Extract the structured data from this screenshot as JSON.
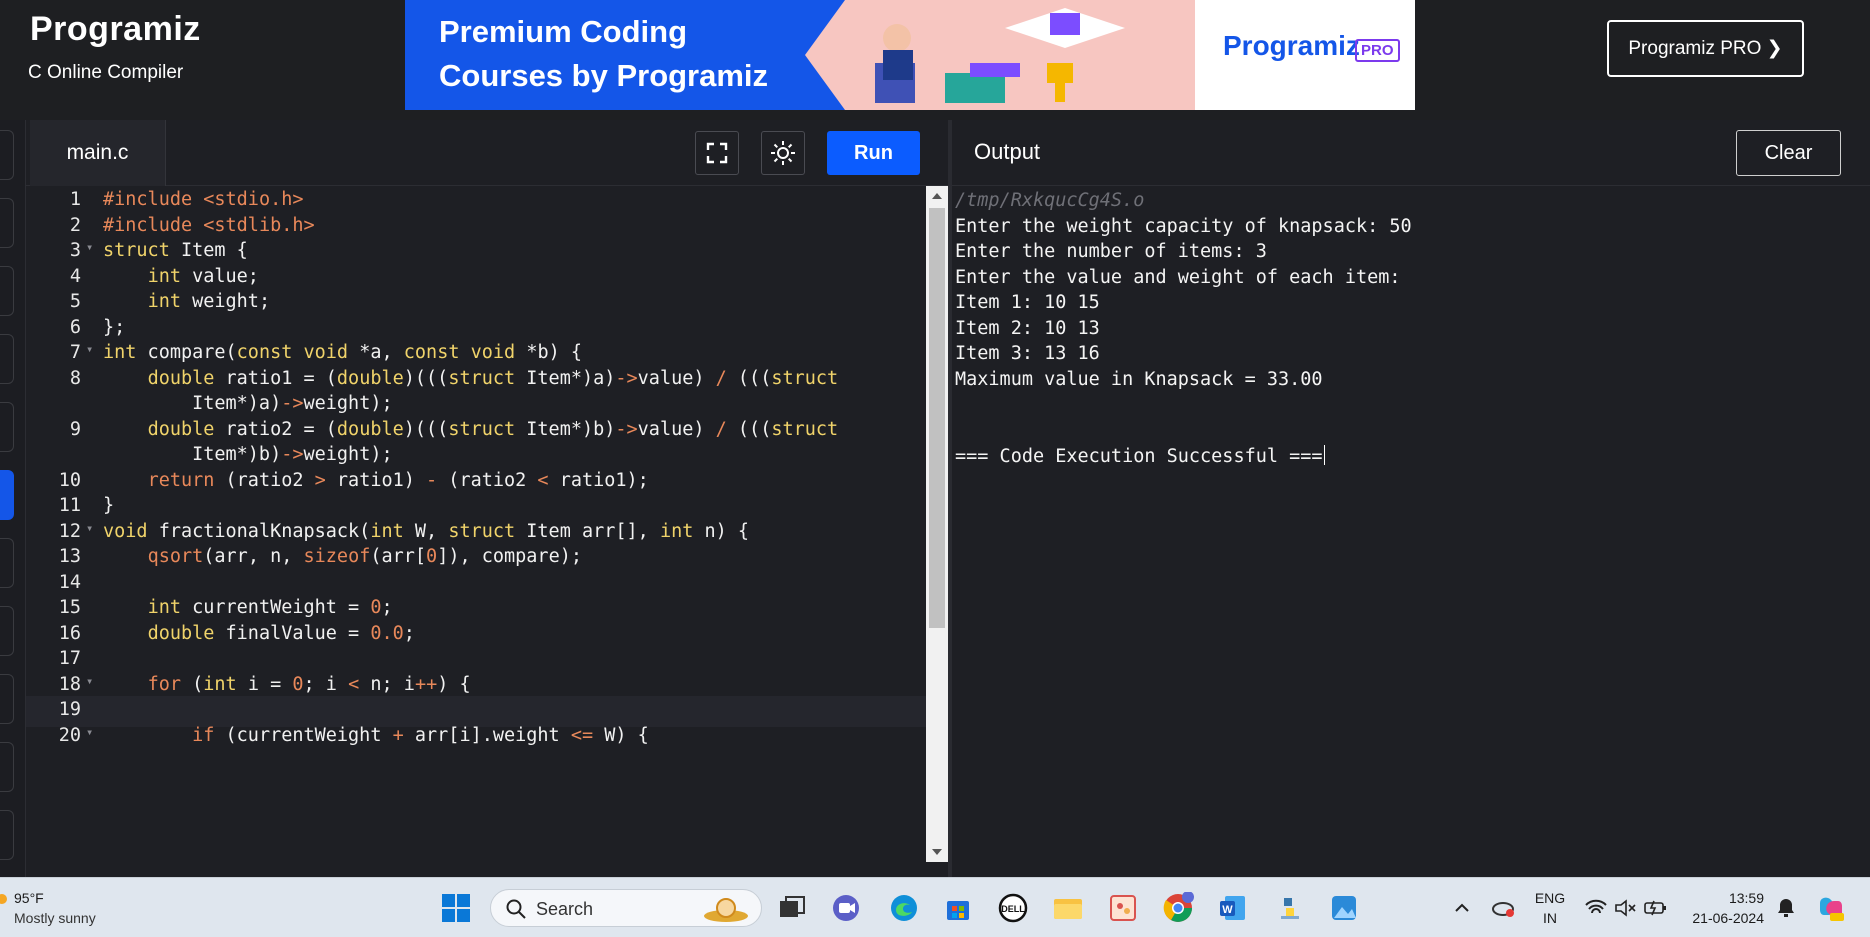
{
  "header": {
    "logo": "Programiz",
    "subtitle": "C Online Compiler",
    "banner_line1": "Premium Coding",
    "banner_line2": "Courses by Programiz",
    "banner_logo": "Programiz",
    "banner_badge": "PRO",
    "pro_button": "Programiz PRO ❯"
  },
  "editor": {
    "tab_label": "main.c",
    "run_label": "Run",
    "lines": [
      {
        "n": "1",
        "fold": false
      },
      {
        "n": "2",
        "fold": false
      },
      {
        "n": "3",
        "fold": true
      },
      {
        "n": "4",
        "fold": false
      },
      {
        "n": "5",
        "fold": false
      },
      {
        "n": "6",
        "fold": false
      },
      {
        "n": "7",
        "fold": true
      },
      {
        "n": "8",
        "fold": false
      },
      {
        "n": "",
        "fold": false
      },
      {
        "n": "9",
        "fold": false
      },
      {
        "n": "",
        "fold": false
      },
      {
        "n": "10",
        "fold": false
      },
      {
        "n": "11",
        "fold": false
      },
      {
        "n": "12",
        "fold": true
      },
      {
        "n": "13",
        "fold": false
      },
      {
        "n": "14",
        "fold": false
      },
      {
        "n": "15",
        "fold": false
      },
      {
        "n": "16",
        "fold": false
      },
      {
        "n": "17",
        "fold": false
      },
      {
        "n": "18",
        "fold": true
      },
      {
        "n": "19",
        "fold": false
      },
      {
        "n": "20",
        "fold": true
      }
    ],
    "code": [
      "#include <stdio.h>",
      "#include <stdlib.h>",
      "struct Item {",
      "    int value;",
      "    int weight;",
      "};",
      "int compare(const void *a, const void *b) {",
      "    double ratio1 = (double)(((struct Item*)a)->value) / (((struct",
      "        Item*)a)->weight);",
      "    double ratio2 = (double)(((struct Item*)b)->value) / (((struct",
      "        Item*)b)->weight);",
      "    return (ratio2 > ratio1) - (ratio2 < ratio1);",
      "}",
      "void fractionalKnapsack(int W, struct Item arr[], int n) {",
      "    qsort(arr, n, sizeof(arr[0]), compare);",
      "",
      "    int currentWeight = 0;",
      "    double finalValue = 0.0;",
      "",
      "    for (int i = 0; i < n; i++) {",
      "",
      "        if (currentWeight + arr[i].weight <= W) {"
    ]
  },
  "output": {
    "title": "Output",
    "clear_label": "Clear",
    "lines": [
      "/tmp/RxkqucCg4S.o",
      "Enter the weight capacity of knapsack: 50",
      "Enter the number of items: 3",
      "Enter the value and weight of each item:",
      "Item 1: 10 15",
      "Item 2: 10 13",
      "Item 3: 13 16",
      "Maximum value in Knapsack = 33.00",
      "",
      "",
      "=== Code Execution Successful ==="
    ]
  },
  "taskbar": {
    "weather_temp": "95°F",
    "weather_desc": "Mostly sunny",
    "search_label": "Search",
    "lang_top": "ENG",
    "lang_bottom": "IN",
    "time": "13:59",
    "date": "21-06-2024",
    "icons": [
      "windows-start-icon",
      "search-icon",
      "task-view-icon",
      "meet-icon",
      "edge-icon",
      "store-icon",
      "dell-icon",
      "file-explorer-icon",
      "paint-icon",
      "chrome-icon",
      "word-icon",
      "python-icon",
      "photos-icon",
      "copilot-icon"
    ]
  },
  "colors": {
    "run": "#0b5cff",
    "keyword": "#f0d36a",
    "string": "#e8885a",
    "editor_bg": "#1e1f24"
  }
}
